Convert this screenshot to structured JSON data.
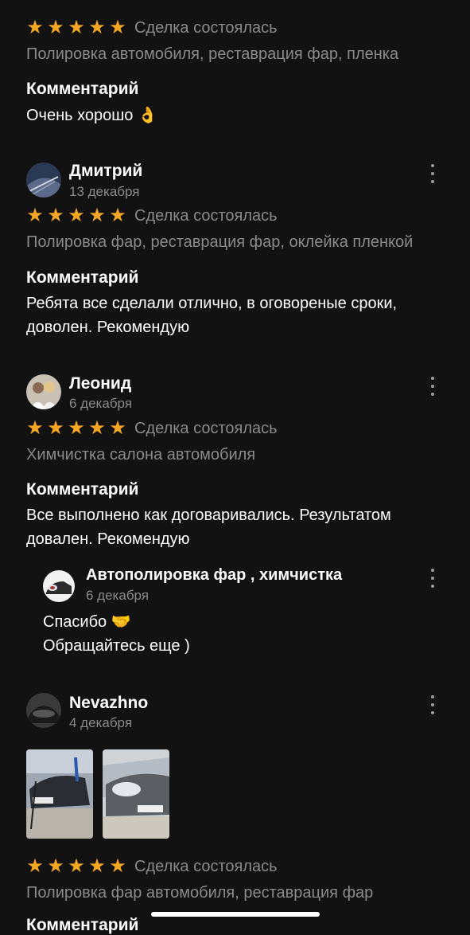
{
  "colors": {
    "background": "#121212",
    "star": "#f5a623",
    "muted": "#8a8a8a",
    "text": "#ffffff"
  },
  "icons": {
    "star": "★",
    "more": "more-vertical-icon"
  },
  "review0": {
    "rating": 5,
    "deal_status": "Сделка состоялась",
    "services": "Полировка автомобиля, реставрация фар, пленка",
    "comment_title": "Комментарий",
    "comment": "Очень хорошо 👌"
  },
  "review1": {
    "author": "Дмитрий",
    "date": "13 декабря",
    "rating": 5,
    "deal_status": "Сделка состоялась",
    "services": "Полировка фар, реставрация фар, оклейка пленкой",
    "comment_title": "Комментарий",
    "comment_line1": "Ребята все сделали отлично, в оговореные сроки,",
    "comment_line2": "доволен. Рекомендую"
  },
  "review2": {
    "author": "Леонид",
    "date": "6 декабря",
    "rating": 5,
    "deal_status": "Сделка состоялась",
    "services": "Химчистка салона автомобиля",
    "comment_title": "Комментарий",
    "comment_line1": "Все выполнено как договаривались. Результатом",
    "comment_line2": "довален. Рекомендую",
    "reply": {
      "author": "Автополировка фар , химчистка",
      "date": "6 декабря",
      "line1": "Спасибо 🤝",
      "line2": "Обращайтесь еще )"
    }
  },
  "review3": {
    "author": "Nevazhno",
    "date": "4 декабря",
    "photos_count": 2,
    "rating": 5,
    "deal_status": "Сделка состоялась",
    "services": "Полировка фар автомобиля, реставрация фар",
    "comment_title": "Комментарий"
  }
}
